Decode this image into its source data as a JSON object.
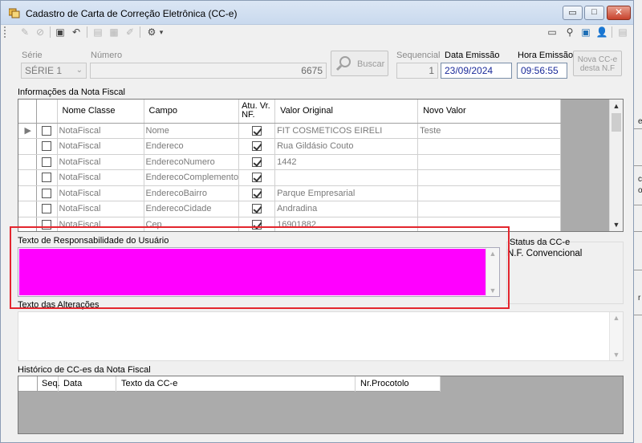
{
  "window": {
    "title": "Cadastro de Carta de Correção Eletrônica (CC-e)"
  },
  "title_buttons": {
    "minimize": "▭",
    "maximize": "□",
    "close": "✕"
  },
  "toolbar": {
    "icons": [
      "edit-icon",
      "cancel-icon",
      "save-icon",
      "undo-icon",
      "print-preview-icon",
      "export-icon",
      "print-icon",
      "tools-dropdown-icon"
    ],
    "glyphs": {
      "edit": "✎",
      "cancel": "⊘",
      "save": "▣",
      "undo": "↶",
      "preview": "▤",
      "export": "▦",
      "erase": "✐",
      "tools": "⚙",
      "dropdown": "▾",
      "right1": "▭",
      "right2": "⚲",
      "right3": "▣",
      "right4": "👤",
      "right5": "▤"
    }
  },
  "header": {
    "serie_label": "Série",
    "serie_value": "SÉRIE 1",
    "numero_label": "Número",
    "numero_value": "6675",
    "buscar_label": "Buscar",
    "sequencial_label": "Sequencial",
    "sequencial_value": "1",
    "data_emissao_label": "Data Emissão",
    "data_emissao_value": "23/09/2024",
    "hora_emissao_label": "Hora Emissão",
    "hora_emissao_value": "09:56:55",
    "nova_cce_label_1": "Nova CC-e",
    "nova_cce_label_2": "desta N.F"
  },
  "info_nf": {
    "label": "Informações da Nota Fiscal",
    "columns": [
      "",
      "",
      "Nome Classe",
      "Campo",
      "Atu. Vr. NF.",
      "Valor Original",
      "Novo Valor"
    ],
    "rows": [
      {
        "classe": "NotaFiscal",
        "campo": "Nome",
        "atu": true,
        "original": "FIT COSMETICOS EIRELI",
        "novo": "Teste",
        "current": true
      },
      {
        "classe": "NotaFiscal",
        "campo": "Endereco",
        "atu": true,
        "original": "Rua Gildásio Couto",
        "novo": ""
      },
      {
        "classe": "NotaFiscal",
        "campo": "EnderecoNumero",
        "atu": true,
        "original": "1442",
        "novo": ""
      },
      {
        "classe": "NotaFiscal",
        "campo": "EnderecoComplemento",
        "atu": true,
        "original": "",
        "novo": ""
      },
      {
        "classe": "NotaFiscal",
        "campo": "EnderecoBairro",
        "atu": true,
        "original": "Parque Empresarial",
        "novo": ""
      },
      {
        "classe": "NotaFiscal",
        "campo": "EnderecoCidade",
        "atu": true,
        "original": "Andradina",
        "novo": ""
      },
      {
        "classe": "NotaFiscal",
        "campo": "Cep",
        "atu": true,
        "original": "16901882",
        "novo": ""
      }
    ]
  },
  "responsabilidade": {
    "label": "Texto de Responsabilidade do Usuário"
  },
  "status": {
    "label": "Status da CC-e",
    "value": "N.F. Convencional"
  },
  "alteracoes": {
    "label": "Texto das Alterações"
  },
  "historico": {
    "label": "Histórico de CC-es da Nota Fiscal",
    "columns": [
      "Seq.",
      "Data",
      "Texto da CC-e",
      "Nr.Procotolo"
    ]
  },
  "scroll": {
    "up": "▲",
    "down": "▼",
    "pointer": "▶"
  },
  "combo_arrow": "⌄",
  "colors": {
    "highlight": "#e3262e",
    "redacted": "#ff00ff",
    "active_text": "#1a2a9a"
  }
}
